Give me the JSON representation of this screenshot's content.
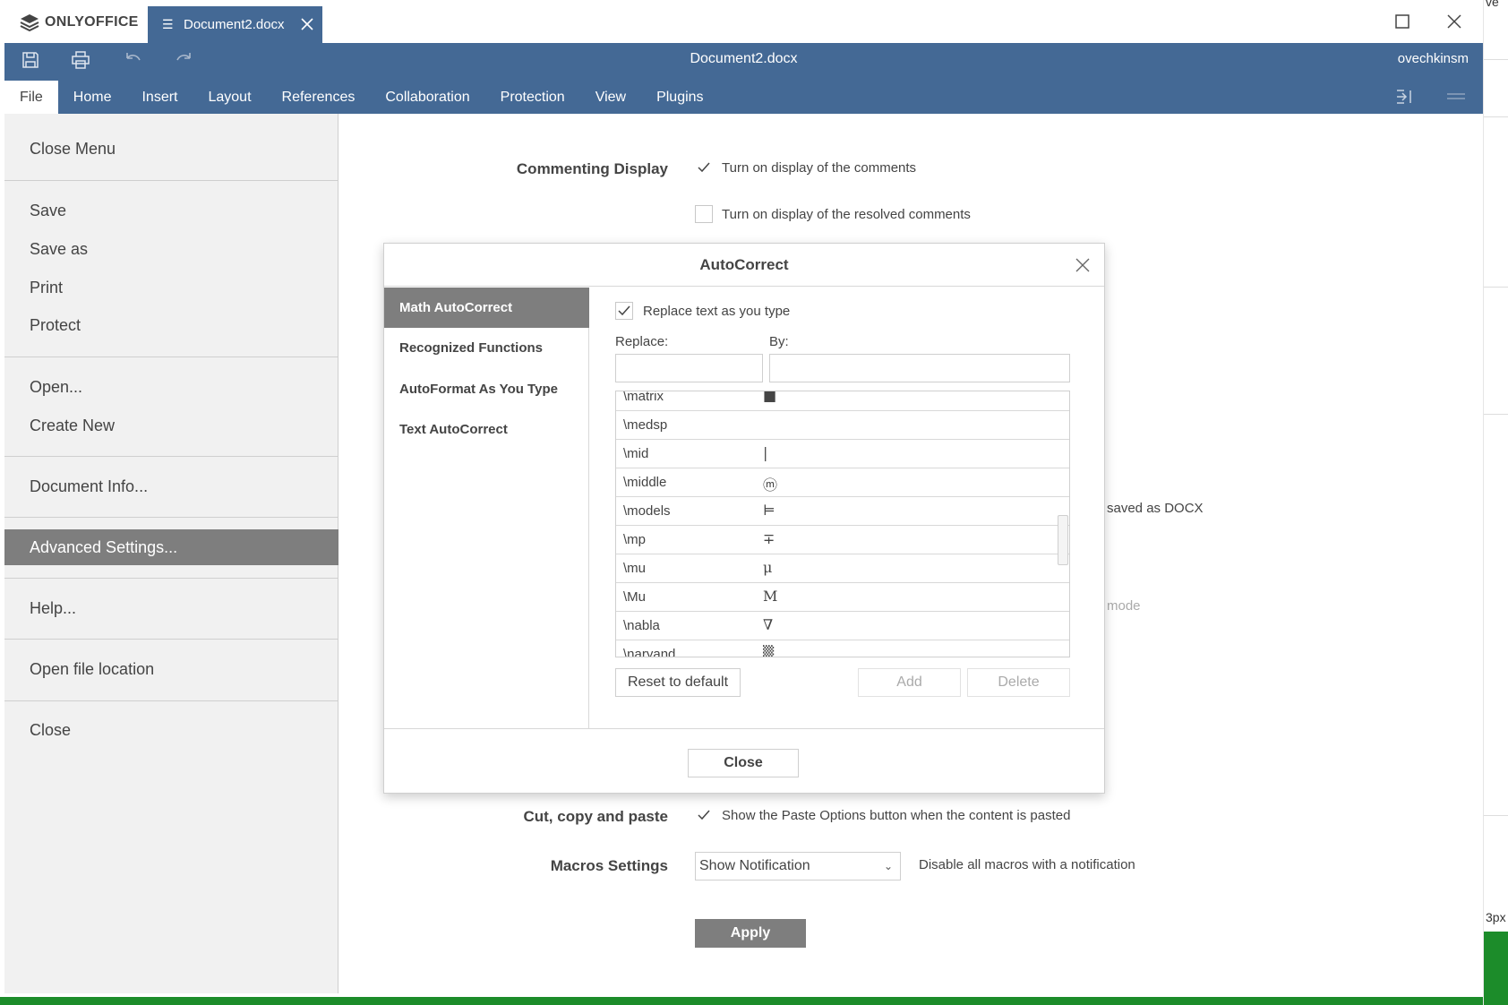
{
  "app": {
    "logo_text": "ONLYOFFICE",
    "tab_title": "Document2.docx",
    "doc_title": "Document2.docx",
    "user": "ovechkinsm"
  },
  "menu_tabs": [
    "File",
    "Home",
    "Insert",
    "Layout",
    "References",
    "Collaboration",
    "Protection",
    "View",
    "Plugins"
  ],
  "file_menu": {
    "close_menu": "Close Menu",
    "save": "Save",
    "save_as": "Save as",
    "print": "Print",
    "protect": "Protect",
    "open": "Open...",
    "create_new": "Create New",
    "document_info": "Document Info...",
    "advanced_settings": "Advanced Settings...",
    "help": "Help...",
    "open_file_location": "Open file location",
    "close": "Close"
  },
  "settings": {
    "commenting_label": "Commenting Display",
    "comments_on": "Turn on display of the comments",
    "resolved_on": "Turn on display of the resolved comments",
    "partial_docx": "saved as DOCX",
    "partial_mode": "mode",
    "cut_copy_label": "Cut, copy and paste",
    "paste_options": "Show the Paste Options button when the content is pasted",
    "macros_label": "Macros Settings",
    "macros_value": "Show Notification",
    "macros_desc": "Disable all macros with a notification",
    "apply": "Apply"
  },
  "dialog": {
    "title": "AutoCorrect",
    "side_items": [
      "Math AutoCorrect",
      "Recognized Functions",
      "AutoFormat As You Type",
      "Text AutoCorrect"
    ],
    "replace_as_you_type": "Replace text as you type",
    "replace_label": "Replace:",
    "by_label": "By:",
    "rows": [
      {
        "key": "\\matrix",
        "val": "■"
      },
      {
        "key": "\\medsp",
        "val": ""
      },
      {
        "key": "\\mid",
        "val": "|"
      },
      {
        "key": "\\middle",
        "val": "ⓜ"
      },
      {
        "key": "\\models",
        "val": "⊨"
      },
      {
        "key": "\\mp",
        "val": "∓"
      },
      {
        "key": "\\mu",
        "val": "μ"
      },
      {
        "key": "\\Mu",
        "val": "M"
      },
      {
        "key": "\\nabla",
        "val": "∇"
      },
      {
        "key": "\\naryand",
        "val": "▒"
      }
    ],
    "reset": "Reset to default",
    "add": "Add",
    "delete": "Delete",
    "close": "Close"
  },
  "bg_window": {
    "frag_top": "ve",
    "frag_px": "3px"
  }
}
